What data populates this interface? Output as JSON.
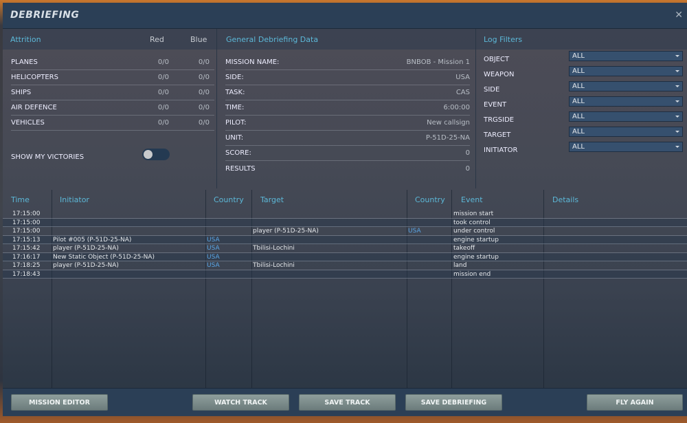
{
  "window": {
    "title": "DEBRIEFING"
  },
  "attrition": {
    "title": "Attrition",
    "col_red": "Red",
    "col_blue": "Blue",
    "rows": [
      {
        "label": "PLANES",
        "red": "0/0",
        "blue": "0/0"
      },
      {
        "label": "HELICOPTERS",
        "red": "0/0",
        "blue": "0/0"
      },
      {
        "label": "SHIPS",
        "red": "0/0",
        "blue": "0/0"
      },
      {
        "label": "AIR DEFENCE",
        "red": "0/0",
        "blue": "0/0"
      },
      {
        "label": "VEHICLES",
        "red": "0/0",
        "blue": "0/0"
      }
    ],
    "show_victories_label": "SHOW MY VICTORIES",
    "show_victories": false
  },
  "general": {
    "title": "General Debriefing Data",
    "rows": [
      {
        "label": "MISSION NAME:",
        "value": "BNBOB - Mission 1"
      },
      {
        "label": "SIDE:",
        "value": "USA"
      },
      {
        "label": "TASK:",
        "value": "CAS"
      },
      {
        "label": "TIME:",
        "value": "6:00:00"
      },
      {
        "label": "PILOT:",
        "value": "New callsign"
      },
      {
        "label": "UNIT:",
        "value": "P-51D-25-NA"
      },
      {
        "label": "SCORE:",
        "value": "0"
      },
      {
        "label": "RESULTS",
        "value": "0"
      }
    ]
  },
  "filters": {
    "title": "Log Filters",
    "rows": [
      {
        "label": "OBJECT",
        "value": "ALL"
      },
      {
        "label": "WEAPON",
        "value": "ALL"
      },
      {
        "label": "SIDE",
        "value": "ALL"
      },
      {
        "label": "EVENT",
        "value": "ALL"
      },
      {
        "label": "TRGSIDE",
        "value": "ALL"
      },
      {
        "label": "TARGET",
        "value": "ALL"
      },
      {
        "label": "INITIATOR",
        "value": "ALL"
      }
    ]
  },
  "log": {
    "headers": [
      "Time",
      "Initiator",
      "Country",
      "Target",
      "Country",
      "Event",
      "Details"
    ],
    "rows": [
      [
        "17:15:00",
        "",
        "",
        "",
        "",
        "mission start",
        ""
      ],
      [
        "17:15:00",
        "",
        "",
        "",
        "",
        "took control",
        ""
      ],
      [
        "17:15:00",
        "",
        "",
        "player (P-51D-25-NA)",
        "USA",
        "under control",
        ""
      ],
      [
        "17:15:13",
        "Pilot #005 (P-51D-25-NA)",
        "USA",
        "",
        "",
        "engine startup",
        ""
      ],
      [
        "17:15:42",
        "player (P-51D-25-NA)",
        "USA",
        "Tbilisi-Lochini",
        "",
        "takeoff",
        ""
      ],
      [
        "17:16:17",
        "New Static Object (P-51D-25-NA)",
        "USA",
        "",
        "",
        "engine startup",
        ""
      ],
      [
        "17:18:25",
        "player (P-51D-25-NA)",
        "USA",
        "Tbilisi-Lochini",
        "",
        "land",
        ""
      ],
      [
        "17:18:43",
        "",
        "",
        "",
        "",
        "mission end",
        ""
      ]
    ]
  },
  "footer": {
    "mission_editor": "MISSION EDITOR",
    "watch_track": "WATCH TRACK",
    "save_track": "SAVE TRACK",
    "save_debriefing": "SAVE DEBRIEFING",
    "fly_again": "FLY AGAIN"
  }
}
